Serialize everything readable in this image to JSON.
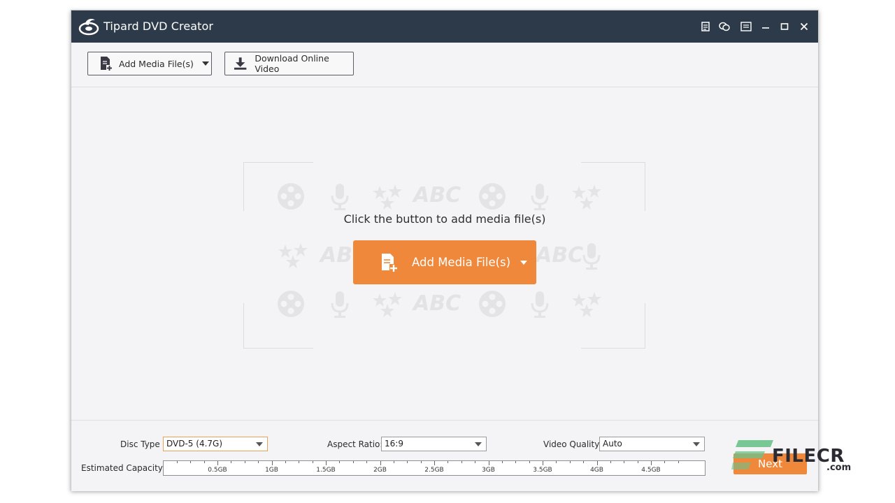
{
  "window": {
    "title": "Tipard DVD Creator",
    "controls": [
      "register-icon",
      "feedback-icon",
      "menu-icon",
      "minimize-icon",
      "maximize-icon",
      "close-icon"
    ]
  },
  "toolbar": {
    "add_media_label": "Add Media File(s)",
    "download_label": "Download Online Video"
  },
  "content": {
    "watermark_text": "ABC",
    "prompt": "Click the button to add media file(s)",
    "add_media_label": "Add Media File(s)"
  },
  "settings": {
    "disc_type_label": "Disc Type",
    "disc_type_value": "DVD-5 (4.7G)",
    "aspect_ratio_label": "Aspect Ratio:",
    "aspect_ratio_value": "16:9",
    "video_quality_label": "Video Quality:",
    "video_quality_value": "Auto",
    "capacity_label": "Estimated Capacity:",
    "capacity_ticks": [
      "0.5GB",
      "1GB",
      "1.5GB",
      "2GB",
      "2.5GB",
      "3GB",
      "3.5GB",
      "4GB",
      "4.5GB"
    ],
    "next_label": "Next"
  },
  "watermark": {
    "brand": "FILECR",
    "suffix": ".com"
  },
  "colors": {
    "titlebar": "#2d3a49",
    "accent": "#f0883c",
    "brand_green": "#6cc28a"
  }
}
